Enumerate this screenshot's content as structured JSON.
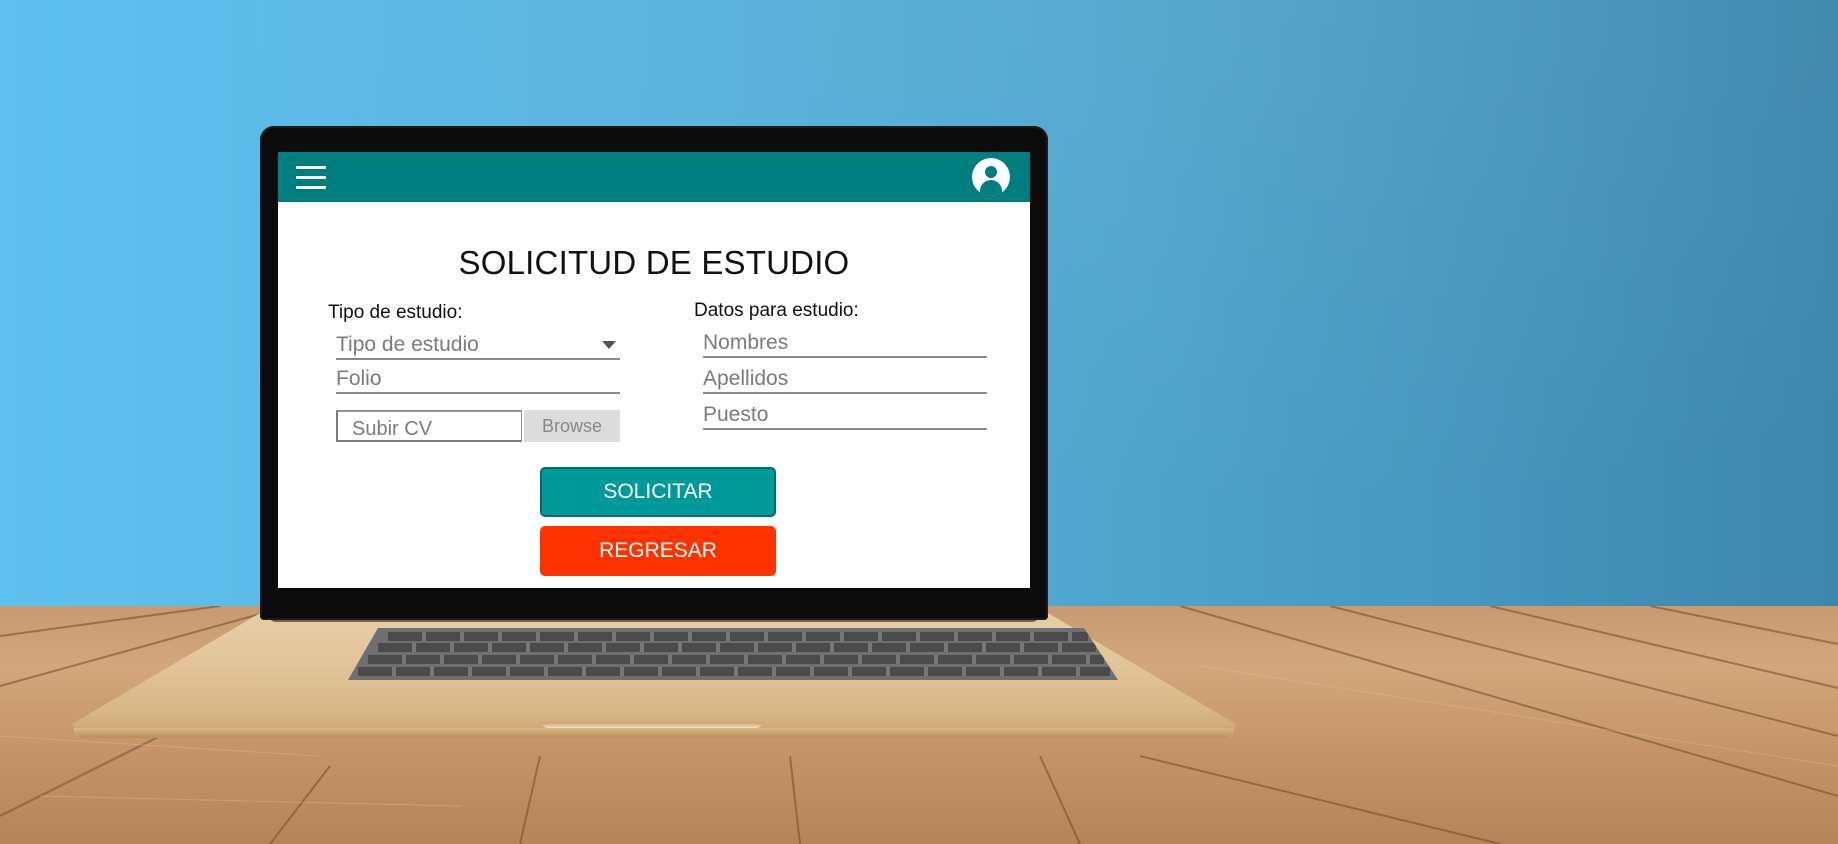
{
  "app": {
    "title": "SOLICITUD DE ESTUDIO"
  },
  "header": {
    "menu_icon": "hamburger-menu-icon",
    "profile_icon": "user-avatar-icon",
    "color": "#007e7e"
  },
  "form": {
    "left": {
      "label": "Tipo de estudio:",
      "study_type": {
        "placeholder": "Tipo de estudio",
        "icon": "chevron-down-icon"
      },
      "folio": {
        "placeholder": "Folio"
      },
      "upload": {
        "placeholder": "Subir CV",
        "button_label": "Browse"
      }
    },
    "right": {
      "label": "Datos para estudio:",
      "names": {
        "placeholder": "Nombres"
      },
      "surnames": {
        "placeholder": "Apellidos"
      },
      "position": {
        "placeholder": "Puesto"
      }
    }
  },
  "actions": {
    "submit_label": "SOLICITAR",
    "back_label": "REGRESAR",
    "submit_color": "#009a9a",
    "back_color": "#ff3300"
  }
}
